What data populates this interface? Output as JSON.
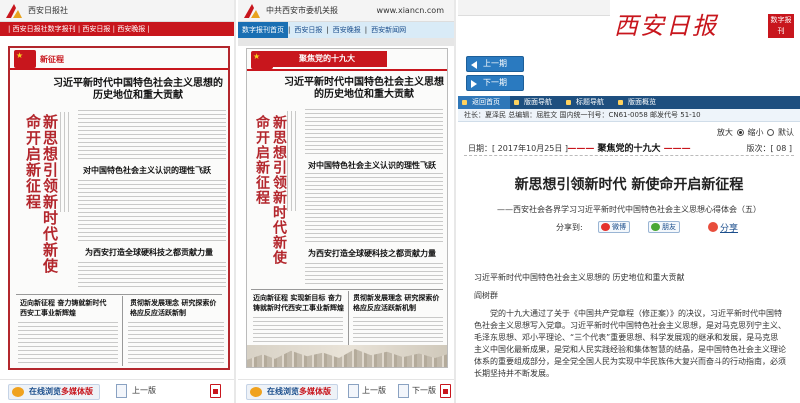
{
  "left": {
    "logo_text": "西安日报社",
    "nav_items": [
      "西安日报社数字报刊",
      "西安日报",
      "西安晚报"
    ],
    "paper": {
      "head_title": "新征程",
      "headline": "习近平新时代中国特色社会主义思想的历史地位和重大贡献",
      "vertical_title": "新思想引领新时代新使命开启新征程",
      "sub1": "对中国特色社会主义认识的理性飞跃",
      "sub2": "为西安打造全球硬科技之都贡献力量",
      "sub3": "迈向新征程 奋力铸就新时代西安工事业新辉煌",
      "sub4": "贯彻新发展理念 研究探索价格应反应活跃新制"
    },
    "bottom": {
      "mm_label_a": "在线浏览",
      "mm_label_b": "多媒体版",
      "prev_label": "上一版"
    }
  },
  "mid": {
    "header_text": "中共西安市委机关报",
    "url": "www.xiancn.com",
    "nav_items": [
      "数字报刊首页",
      "西安日报",
      "西安晚报",
      "西安新闻网"
    ],
    "paper": {
      "banner": "聚焦党的十九大",
      "headline": "习近平新时代中国特色社会主义思想的历史地位和重大贡献",
      "vertical_title": "新思想引领新时代新使命开启新征程",
      "sub1": "对中国特色社会主义认识的理性飞跃",
      "sub2": "为西安打造全球硬科技之都贡献力量",
      "sub3": "迈向新征程 实现新目标 奋力铸就新时代西安工事业新辉煌",
      "sub4": "贯彻新发展理念 研究探索价格应反应活跃新机制"
    },
    "bottom": {
      "mm_label_a": "在线浏览",
      "mm_label_b": "多媒体版",
      "prev_label": "上一版",
      "next_label": "下一版"
    }
  },
  "right": {
    "brand_name": "西安日报",
    "brand_tag": "数字报刊",
    "prev_issue": "上一期",
    "next_issue": "下一期",
    "menu": [
      "返回首页",
      "版面导航",
      "标题导航",
      "版面概览"
    ],
    "meta": "社长：夏泽民 总编辑：屈胜文 国内统一刊号：CN61-0058 邮发代号 51-10",
    "zoom_enlarge": "放大",
    "zoom_shrink": "缩小",
    "zoom_default": "默认",
    "date": "日期：[ 2017年10月25日 ]",
    "section": "聚焦党的十九大",
    "page": "版次：[ 08 ]",
    "article_title": "新思想引领新时代  新使命开启新征程",
    "article_subtitle": "——西安社会各界学习习近平新时代中国特色社会主义思想心得体会（五）",
    "share_label": "分享到:",
    "share_weibo": "微博",
    "share_friends": "朋友",
    "share_more": "分享",
    "body_heading": "习近平新时代中国特色社会主义思想的 历史地位和重大贡献",
    "author": "阎树群",
    "body_text": "党的十九大通过了关于《中国共产党章程（修正案）》的决议，习近平新时代中国特色社会主义思想写入党章。习近平新时代中国特色社会主义思想，是对马克思列宁主义、毛泽东思想、邓小平理论、“三个代表”重要思想、科学发展观的继承和发展，是马克思主义中国化最新成果，是党和人民实践经验和集体智慧的结晶，是中国特色社会主义理论体系的重要组成部分，是全党全国人民为实现中华民族伟大复兴而奋斗的行动指南，必须长期坚持并不断发展。"
  },
  "colors": {
    "red": "#c8161d",
    "blue": "#2a7ac0",
    "navy": "#1e4f7f"
  }
}
